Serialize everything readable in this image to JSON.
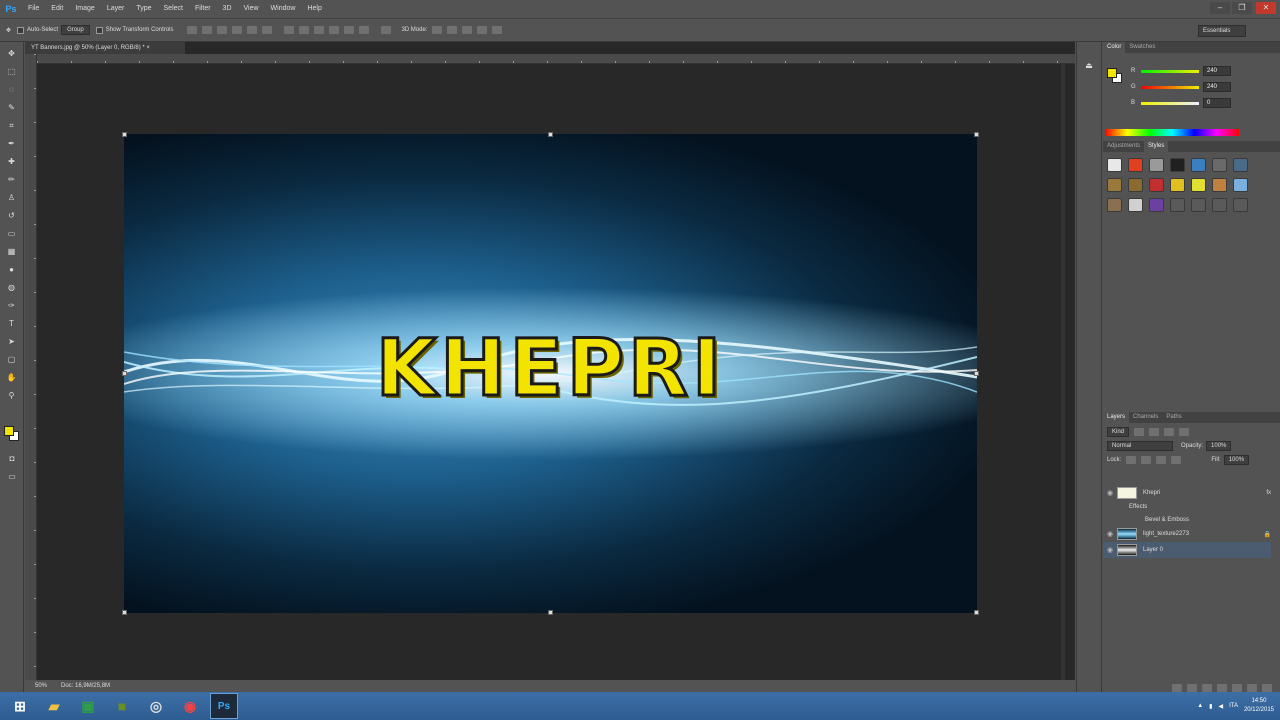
{
  "app": {
    "logo": "Ps",
    "menu": [
      "File",
      "Edit",
      "Image",
      "Layer",
      "Type",
      "Select",
      "Filter",
      "3D",
      "View",
      "Window",
      "Help"
    ]
  },
  "options": {
    "auto_select_label": "Auto-Select",
    "auto_select_value": "Group",
    "show_transform_label": "Show Transform Controls",
    "mode_3d": "3D Mode:",
    "workspace": "Essentials"
  },
  "document": {
    "tab_title": "YT Banners.jpg @ 50% (Layer 0, RGB/8) *",
    "zoom": "50%",
    "doc_size": "Doc: 16,9M/25,8M",
    "banner_text": "KHEPRI"
  },
  "color_panel": {
    "tabs": [
      "Color",
      "Swatches"
    ],
    "r_label": "R",
    "g_label": "G",
    "b_label": "B",
    "r": "240",
    "g": "240",
    "b": "0"
  },
  "styles_panel": {
    "tabs": [
      "Adjustments",
      "Styles"
    ],
    "swatches": [
      "#e8e8e8",
      "#e04020",
      "#9a9a9a",
      "#202020",
      "#3a80c0",
      "#6a6a6a",
      "#4a6a8a",
      "#9a7a3a",
      "#8a6a30",
      "#c03030",
      "#e0c020",
      "#e0e030",
      "#c08040",
      "#7ab0e0",
      "#8a7050",
      "#d0d0d0",
      "#6a40a0",
      "#5a5a5a",
      "#5a5a5a",
      "#5a5a5a",
      "#5a5a5a"
    ]
  },
  "layers_panel": {
    "tabs": [
      "Layers",
      "Channels",
      "Paths"
    ],
    "kind": "Kind",
    "blend": "Normal",
    "opacity_label": "Opacity:",
    "opacity": "100%",
    "lock_label": "Lock:",
    "fill_label": "Fill:",
    "fill": "100%",
    "layers": [
      {
        "name": "Khepri",
        "fx": "fx"
      },
      {
        "name": "Effects"
      },
      {
        "name": "Bevel & Emboss"
      },
      {
        "name": "light_texture2273"
      },
      {
        "name": "Layer 0"
      }
    ]
  },
  "taskbar": {
    "lang": "ITA",
    "time": "14:50",
    "date": "20/12/2015"
  }
}
